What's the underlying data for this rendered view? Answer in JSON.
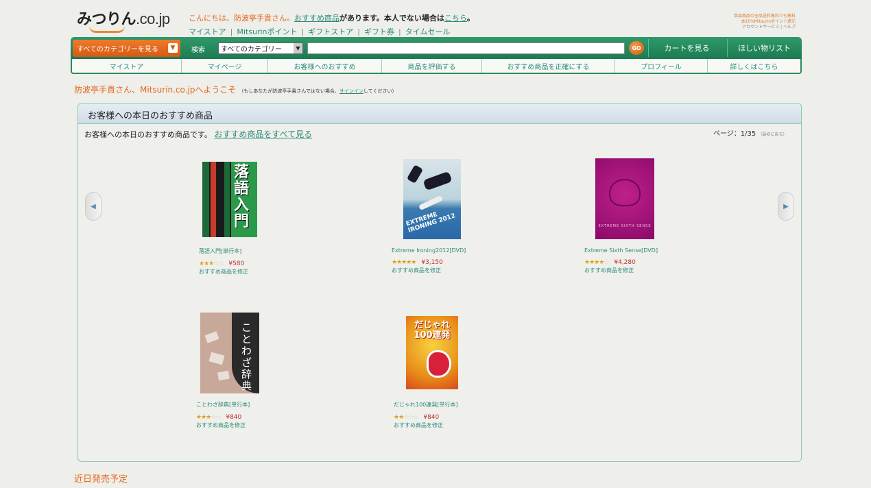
{
  "header": {
    "logo_main": "みつりん",
    "logo_domain": ".co.jp",
    "greeting_prefix": "こんにちは、防波亭手貴さん。",
    "greeting_link": "おすすめ商品",
    "greeting_mid": "があります。本人でない場合は",
    "greeting_here": "こちら",
    "greeting_end": "。",
    "topnav": [
      "マイストア",
      "Mitsurinポイント",
      "ギフトストア",
      "ギフト券",
      "タイムセール"
    ],
    "promo_line1": "単品商品の全品送料無料でも無料",
    "promo_line2": "本10%Mitsurinポイント還元",
    "promo_line3": "アカウントサービス | ヘルプ"
  },
  "searchbar": {
    "category_button": "すべてのカテゴリーを見る",
    "search_label": "検索",
    "category_select": "すべてのカテゴリー",
    "go_label": "GO",
    "cart_button": "カートを見る",
    "wishlist_button": "ほしい物リスト"
  },
  "subnav": [
    "マイストア",
    "マイページ",
    "お客様へのおすすめ",
    "商品を評価する",
    "おすすめ商品を正確にする",
    "プロフィール",
    "詳しくはこちら"
  ],
  "welcome": {
    "text": "防波亭手貴さん、Mitsurin.co.jpへようこそ",
    "note_prefix": "（もしあなたが防波亭手貴さんではない場合、",
    "note_link": "サインイン",
    "note_suffix": "してください）"
  },
  "recommend": {
    "title": "お客様への本日のおすすめ商品",
    "desc": "お客様への本日のおすすめ商品です。",
    "see_all": "おすすめ商品をすべて見る",
    "page_info": "ページ：1/35",
    "page_note": "（最初に戻る）",
    "products": [
      {
        "name": "落語入門[単行本]",
        "stars": 3,
        "price": "¥580",
        "fix": "おすすめ商品を修正",
        "cover_text": "落語入門"
      },
      {
        "name": "Extreme Ironing2012[DVD]",
        "stars": 5,
        "price": "¥3,150",
        "fix": "おすすめ商品を修正",
        "cover_text": "EXTREME IRONING 2012"
      },
      {
        "name": "Extreme Sixth Sense[DVD]",
        "stars": 4,
        "price": "¥4,280",
        "fix": "おすすめ商品を修正",
        "cover_text": "EXTREME SIXTH SENSE"
      },
      {
        "name": "ことわざ辞典[単行本]",
        "stars": 3,
        "price": "¥840",
        "fix": "おすすめ商品を修正",
        "cover_text": "ことわざ辞典"
      },
      {
        "name": "だじゃれ100連発[単行本]",
        "stars": 2,
        "price": "¥840",
        "fix": "おすすめ商品を修正",
        "cover_text": "だじゃれ100連発"
      }
    ]
  },
  "upcoming": "近日発売予定",
  "colors": {
    "brand_green": "#1d7a52",
    "accent_orange": "#e6661e",
    "link_teal": "#2a8a7a"
  }
}
